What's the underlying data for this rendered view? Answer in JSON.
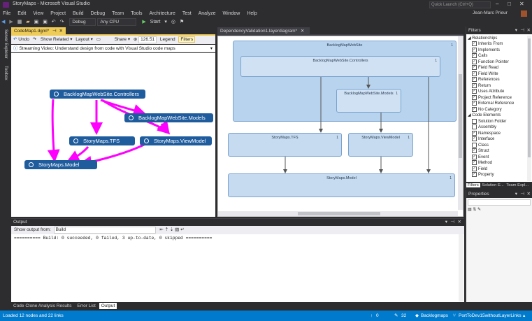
{
  "app": {
    "title": "StoryMaps - Microsoft Visual Studio",
    "quick_launch_placeholder": "Quick Launch (Ctrl+Q)",
    "user": "Jean-Marc Prieur"
  },
  "menu": [
    "File",
    "Edit",
    "View",
    "Project",
    "Build",
    "Debug",
    "Team",
    "Tools",
    "Architecture",
    "Test",
    "Analyze",
    "Window",
    "Help"
  ],
  "toolbar": {
    "config": "Debug",
    "platform": "Any CPU",
    "start": "Start"
  },
  "side_tabs": [
    "Server Explorer",
    "Toolbox"
  ],
  "codemap": {
    "tab": "CodeMap1.dgml*",
    "undo": "Undo",
    "show_related": "Show Related",
    "layout": "Layout",
    "share": "Share",
    "zoom": "126.51",
    "legend": "Legend",
    "filters": "Filters",
    "banner": "Streaming Video: Understand design from code with Visual Studio code maps",
    "nodes": {
      "controllers": "BacklogMapWebSite.Controllers",
      "models": "BacklogMapWebSite.Models",
      "tfs": "StoryMaps.TFS",
      "viewmodel": "StoryMaps.ViewModel",
      "model": "StoryMaps.Model"
    }
  },
  "layer": {
    "tab": "DependencyValidation1.layerdiagram*",
    "website": "BacklogMapWebSite",
    "controllers": "BacklogMapWebSite.Controllers",
    "models": "BacklogMapWebSite.Models",
    "tfs": "StoryMaps.TFS",
    "viewmodel": "StoryMaps.ViewModel",
    "model": "StoryMaps.Model",
    "count": "1"
  },
  "filters_panel": {
    "title": "Filters",
    "relationships_header": "Relationships",
    "relationships": [
      "Inherits From",
      "Implements",
      "Calls",
      "Function Pointer",
      "Field Read",
      "Field Write",
      "References",
      "Return",
      "Uses Attribute",
      "Project Reference",
      "External Reference",
      "No Category"
    ],
    "code_elements_header": "Code Elements",
    "code_elements": [
      {
        "label": "Solution Folder",
        "checked": false
      },
      {
        "label": "Assembly",
        "checked": false
      },
      {
        "label": "Namespace",
        "checked": true
      },
      {
        "label": "Interface",
        "checked": true
      },
      {
        "label": "Class",
        "checked": false
      },
      {
        "label": "Struct",
        "checked": true
      },
      {
        "label": "Event",
        "checked": true
      },
      {
        "label": "Method",
        "checked": true
      },
      {
        "label": "Field",
        "checked": true
      },
      {
        "label": "Property",
        "checked": true
      }
    ],
    "tabs": [
      "Filters",
      "Solution E...",
      "Team Expl..."
    ]
  },
  "properties": {
    "title": "Properties"
  },
  "output": {
    "title": "Output",
    "show_from_label": "Show output from:",
    "source": "Build",
    "text": "========== Build: 0 succeeded, 0 failed, 3 up-to-date, 0 skipped =========="
  },
  "bottom_tabs": [
    "Code Clone Analysis Results",
    "Error List",
    "Output"
  ],
  "status": {
    "message": "Loaded 12 nodes and 22 links",
    "up": "0",
    "pencil": "32",
    "repo": "Backlogmaps",
    "branch": "PortToDev15withoutLayerLinks"
  },
  "colors": {
    "accent": "#007acc",
    "node": "#1f5c9e",
    "link": "#ff00ff",
    "layer_fill": "#b8d3ee"
  }
}
